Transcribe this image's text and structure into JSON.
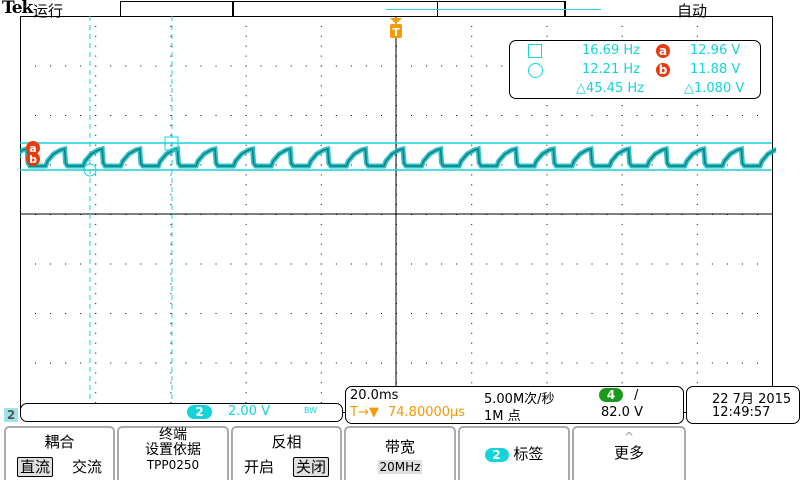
{
  "header": {
    "brand": "Tek",
    "run_state": "运行",
    "trigger_mode": "自动",
    "trigger_marker": "T"
  },
  "measurements": {
    "cursor1_freq": "16.69 Hz",
    "cursor1_volt": "12.96 V",
    "cursor1_badge": "a",
    "cursor2_freq": "12.21 Hz",
    "cursor2_volt": "11.88 V",
    "cursor2_badge": "b",
    "delta_freq": "△45.45 Hz",
    "delta_volt": "△1.080 V"
  },
  "channel": {
    "number": "2",
    "scale": "2.00 V",
    "bw_label": "BW",
    "side_marker": "2"
  },
  "horizontal": {
    "timebase": "20.0ms",
    "sample_rate": "5.00M次/秒",
    "trigger_position": "74.80000µs",
    "trigger_prefix": "T→▼",
    "record_length": "1M 点",
    "trigger_source": "4",
    "trigger_slope": "/",
    "trigger_level": "82.0 V"
  },
  "datetime": {
    "date": "22 7月 2015",
    "time": "12:49:57"
  },
  "menu": {
    "coupling": {
      "label": "耦合",
      "opt1": "直流",
      "opt2": "交流"
    },
    "termination": {
      "line1": "终端",
      "line2": "设置依据",
      "line3": "TPP0250"
    },
    "invert": {
      "label": "反相",
      "opt1": "开启",
      "opt2": "关闭"
    },
    "bandwidth": {
      "label": "带宽",
      "value": "20MHz"
    },
    "label": {
      "num": "2",
      "label": "标签"
    },
    "more": {
      "label": "更多"
    }
  },
  "colors": {
    "trace": "#14d4da",
    "trigger": "#f59a00",
    "cursor_badge": "#e63c0c",
    "trig_source": "#1a9a1a"
  }
}
